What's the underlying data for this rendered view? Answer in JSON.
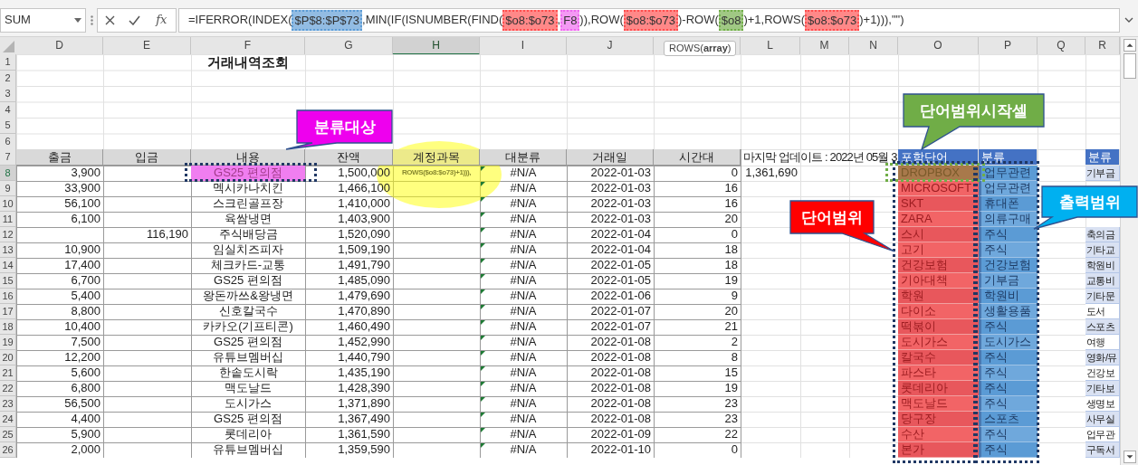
{
  "name_box": "SUM",
  "function_label": "fx",
  "formula": [
    {
      "text": "=IFERROR(INDEX("
    },
    {
      "text": "$P$8:$P$73",
      "color": "#5b9bd5"
    },
    {
      "text": ",MIN(IF(ISNUMBER(FIND("
    },
    {
      "text": "$o8:$o73",
      "color": "#ff4d4d"
    },
    {
      "text": ","
    },
    {
      "text": "F8",
      "color": "#ee66ee"
    },
    {
      "text": ")),ROW("
    },
    {
      "text": "$o8:$o73",
      "color": "#ff4d4d"
    },
    {
      "text": ")-ROW("
    },
    {
      "text": "$o8",
      "color": "#70ad47"
    },
    {
      "text": ")+1,ROWS("
    },
    {
      "text": "$o8:$o73",
      "color": "#ff4d4d"
    },
    {
      "text": ")+1))),\"\")"
    }
  ],
  "tooltip": "ROWS(**array**)",
  "columns": [
    {
      "label": "D",
      "selected": false
    },
    {
      "label": "E",
      "selected": false
    },
    {
      "label": "F",
      "selected": false
    },
    {
      "label": "G",
      "selected": false
    },
    {
      "label": "H",
      "selected": true
    },
    {
      "label": "I",
      "selected": false
    },
    {
      "label": "J",
      "selected": false
    },
    {
      "selected": false
    },
    {
      "label": "L",
      "selected": false
    },
    {
      "label": "M",
      "selected": false
    },
    {
      "label": "N",
      "selected": false
    },
    {
      "label": "O",
      "selected": false
    },
    {
      "label": "P",
      "selected": false
    },
    {
      "label": "Q",
      "selected": false
    },
    {
      "label": "R",
      "selected": false
    }
  ],
  "top_row_numbers": [
    "1",
    "2",
    "3",
    "4",
    "5",
    "6",
    "7"
  ],
  "title": "거래내역조회",
  "headers": [
    "출금",
    "입금",
    "내용",
    "잔액",
    "계정과목",
    "대분류",
    "거래일",
    "시간대"
  ],
  "last_update": "마지막 업데이트 : 2022년 05월 3",
  "last_balance": "1,361,690",
  "keyword_header": "포함단어",
  "category_header": "분류",
  "list_header": "분류",
  "rows": [
    {
      "number": "8",
      "selected": true,
      "out": "3,900",
      "content": "GS25 편의점",
      "balance": "1,500,000",
      "account": "ROWS($o8:$o73)+1))),",
      "category": "#N/A",
      "error_flag": true,
      "date": "2022-01-03",
      "hour": "0",
      "keyword": "DROPBOX",
      "group": "업무관련",
      "list": {
        "text": "기부금",
        "shaded": true
      }
    },
    {
      "number": "9",
      "selected": false,
      "out": "33,900",
      "content": "멕시카나치킨",
      "balance": "1,466,100",
      "category": "#N/A",
      "error_flag": true,
      "date": "2022-01-03",
      "hour": "16",
      "keyword": "MICROSOFT",
      "group": "업무관련"
    },
    {
      "number": "10",
      "selected": false,
      "out": "56,100",
      "content": "스크린골프장",
      "balance": "1,410,000",
      "category": "#N/A",
      "error_flag": true,
      "date": "2022-01-03",
      "hour": "16",
      "keyword": "SKT",
      "group": "휴대폰"
    },
    {
      "number": "11",
      "selected": false,
      "out": "6,100",
      "content": "육쌈냉면",
      "balance": "1,403,900",
      "category": "#N/A",
      "error_flag": true,
      "date": "2022-01-03",
      "hour": "20",
      "keyword": "ZARA",
      "group": "의류구매"
    },
    {
      "number": "12",
      "selected": false,
      "in": "116,190",
      "content": "주식배당금",
      "balance": "1,520,090",
      "category": "#N/A",
      "error_flag": true,
      "date": "2022-01-04",
      "hour": "0",
      "keyword": "스시",
      "group": "주식",
      "list": {
        "text": "축의금",
        "shaded": true
      }
    },
    {
      "number": "13",
      "selected": false,
      "out": "10,900",
      "content": "임실치즈피자",
      "balance": "1,509,190",
      "category": "#N/A",
      "error_flag": true,
      "date": "2022-01-04",
      "hour": "18",
      "keyword": "고기",
      "group": "주식",
      "list": {
        "text": "기타교",
        "shaded": true
      }
    },
    {
      "number": "14",
      "selected": false,
      "out": "17,400",
      "content": "체크카드-교통",
      "balance": "1,491,790",
      "category": "#N/A",
      "error_flag": true,
      "date": "2022-01-05",
      "hour": "18",
      "keyword": "건강보험",
      "group": "건강보험",
      "list": {
        "text": "학원비",
        "shaded": true
      }
    },
    {
      "number": "15",
      "selected": false,
      "out": "6,700",
      "content": "GS25 편의점",
      "balance": "1,485,090",
      "category": "#N/A",
      "error_flag": true,
      "date": "2022-01-05",
      "hour": "19",
      "keyword": "기아대책",
      "group": "기부금",
      "list": {
        "text": "교통비",
        "shaded": true
      }
    },
    {
      "number": "16",
      "selected": false,
      "out": "5,400",
      "content": "왕돈까쓰&왕냉면",
      "balance": "1,479,690",
      "category": "#N/A",
      "error_flag": true,
      "date": "2022-01-06",
      "hour": "9",
      "keyword": "학원",
      "group": "학원비",
      "list": {
        "text": "기타문",
        "shaded": true
      }
    },
    {
      "number": "17",
      "selected": false,
      "out": "8,800",
      "content": "신호칼국수",
      "balance": "1,470,890",
      "category": "#N/A",
      "error_flag": true,
      "date": "2022-01-07",
      "hour": "20",
      "keyword": "다이소",
      "group": "생활용품",
      "list": {
        "text": "도서",
        "shaded": false
      }
    },
    {
      "number": "18",
      "selected": false,
      "out": "10,400",
      "content": "카카오(기프티콘)",
      "balance": "1,460,490",
      "category": "#N/A",
      "error_flag": true,
      "date": "2022-01-07",
      "hour": "21",
      "keyword": "떡볶이",
      "group": "주식",
      "list": {
        "text": "스포츠",
        "shaded": true
      }
    },
    {
      "number": "19",
      "selected": false,
      "out": "7,500",
      "content": "GS25 편의점",
      "balance": "1,452,990",
      "category": "#N/A",
      "error_flag": true,
      "date": "2022-01-08",
      "hour": "2",
      "keyword": "도시가스",
      "group": "도시가스",
      "list": {
        "text": "여행",
        "shaded": false
      }
    },
    {
      "number": "20",
      "selected": false,
      "out": "12,200",
      "content": "유튜브멤버십",
      "balance": "1,440,790",
      "category": "#N/A",
      "error_flag": true,
      "date": "2022-01-08",
      "hour": "8",
      "keyword": "칼국수",
      "group": "주식",
      "list": {
        "text": "영화/뮤",
        "shaded": true
      }
    },
    {
      "number": "21",
      "selected": false,
      "out": "5,600",
      "content": "한솥도시락",
      "balance": "1,435,190",
      "category": "#N/A",
      "error_flag": true,
      "date": "2022-01-08",
      "hour": "15",
      "keyword": "파스타",
      "group": "주식",
      "list": {
        "text": "건강보",
        "shaded": false
      }
    },
    {
      "number": "22",
      "selected": false,
      "out": "6,800",
      "content": "맥도날드",
      "balance": "1,428,390",
      "category": "#N/A",
      "error_flag": true,
      "date": "2022-01-08",
      "hour": "19",
      "keyword": "롯데리아",
      "group": "주식",
      "list": {
        "text": "기타보",
        "shaded": true
      }
    },
    {
      "number": "23",
      "selected": false,
      "out": "56,500",
      "content": "도시가스",
      "balance": "1,371,890",
      "category": "#N/A",
      "error_flag": true,
      "date": "2022-01-08",
      "hour": "23",
      "keyword": "맥도날드",
      "group": "주식",
      "list": {
        "text": "생명보",
        "shaded": false
      }
    },
    {
      "number": "24",
      "selected": false,
      "out": "4,400",
      "content": "GS25 편의점",
      "balance": "1,367,490",
      "category": "#N/A",
      "error_flag": true,
      "date": "2022-01-08",
      "hour": "23",
      "keyword": "당구장",
      "group": "스포츠",
      "list": {
        "text": "사무실",
        "shaded": true
      }
    },
    {
      "number": "25",
      "selected": false,
      "out": "5,900",
      "content": "롯데리아",
      "balance": "1,361,590",
      "category": "#N/A",
      "error_flag": true,
      "date": "2022-01-09",
      "hour": "22",
      "keyword": "수산",
      "group": "주식",
      "list": {
        "text": "업무관",
        "shaded": false
      }
    },
    {
      "number": "26",
      "selected": false,
      "out": "2,000",
      "content": "유튜브멤버십",
      "balance": "1,359,590",
      "category": "#N/A",
      "error_flag": true,
      "date": "2022-01-10",
      "hour": "0",
      "keyword": "본가",
      "group": "주식",
      "list": {
        "text": "구독서",
        "shaded": true
      }
    }
  ],
  "annotations": [
    {
      "text": "분류대상",
      "color": "#ee00ee"
    },
    {
      "text": "단어범위시작셀",
      "color": "#70ad47"
    },
    {
      "text": "단어범위",
      "color": "#ff0000"
    },
    {
      "text": "출력범위",
      "color": "#00b0f0"
    }
  ]
}
